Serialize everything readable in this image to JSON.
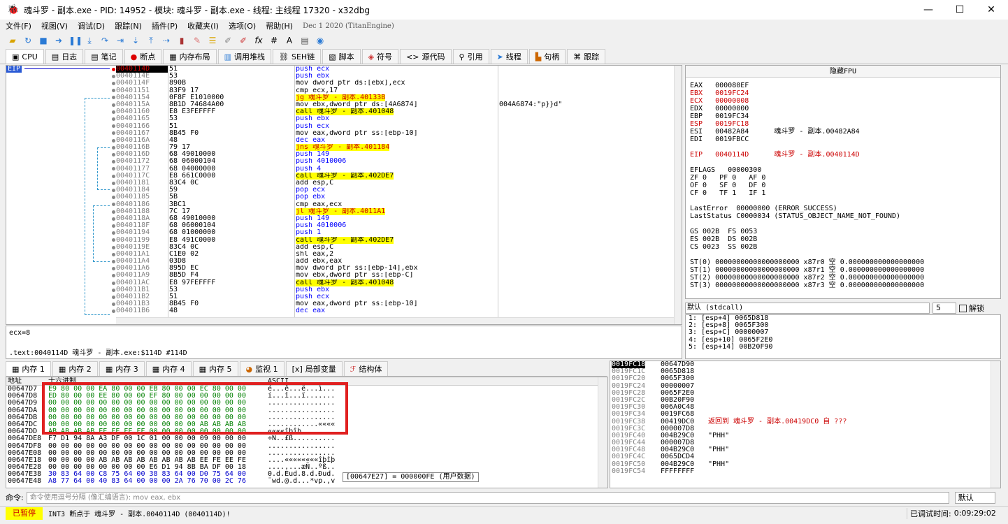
{
  "window": {
    "title": "魂斗罗 - 副本.exe - PID: 14952 - 模块: 魂斗罗 - 副本.exe - 线程: 主线程 17320 - x32dbg"
  },
  "menu": [
    "文件(F)",
    "视图(V)",
    "调试(D)",
    "跟踪(N)",
    "插件(P)",
    "收藏夹(I)",
    "选项(O)",
    "帮助(H)"
  ],
  "menu_date": "Dec 1 2020 (TitanEngine)",
  "tabs": [
    "CPU",
    "日志",
    "笔记",
    "断点",
    "内存布局",
    "调用堆栈",
    "SEH链",
    "脚本",
    "符号",
    "源代码",
    "引用",
    "线程",
    "句柄",
    "跟踪"
  ],
  "eip_label": "EIP",
  "disasm": [
    {
      "addr": "0040114D",
      "bytes": "51",
      "asm": "push ecx",
      "kind": "blue",
      "eip": true
    },
    {
      "addr": "0040114E",
      "bytes": "53",
      "asm": "push ebx",
      "kind": "blue"
    },
    {
      "addr": "0040114F",
      "bytes": "890B",
      "asm": "mov dword ptr ds:[ebx],ecx",
      "kind": "plain"
    },
    {
      "addr": "00401151",
      "bytes": "83F9 17",
      "asm": "cmp ecx,17",
      "kind": "plain"
    },
    {
      "addr": "00401154",
      "bytes": "0F8F E1010000",
      "asm": "jg 魂斗罗 - 副本.40133B",
      "kind": "j"
    },
    {
      "addr": "0040115A",
      "bytes": "8B1D 74684A00",
      "asm": "mov ebx,dword ptr ds:[4A6874]",
      "kind": "plain",
      "cmt": "004A6874:\"p}}d\""
    },
    {
      "addr": "00401160",
      "bytes": "E8 E3FEFFFF",
      "asm": "call 魂斗罗 - 副本.401048",
      "kind": "call"
    },
    {
      "addr": "00401165",
      "bytes": "53",
      "asm": "push ebx",
      "kind": "blue"
    },
    {
      "addr": "00401166",
      "bytes": "51",
      "asm": "push ecx",
      "kind": "blue"
    },
    {
      "addr": "00401167",
      "bytes": "8B45 F0",
      "asm": "mov eax,dword ptr ss:[ebp-10]",
      "kind": "plain"
    },
    {
      "addr": "0040116A",
      "bytes": "48",
      "asm": "dec eax",
      "kind": "blue"
    },
    {
      "addr": "0040116B",
      "bytes": "79 17",
      "asm": "jns 魂斗罗 - 副本.401184",
      "kind": "j"
    },
    {
      "addr": "0040116D",
      "bytes": "68 49010000",
      "asm": "push 149",
      "kind": "blue"
    },
    {
      "addr": "00401172",
      "bytes": "68 06000104",
      "asm": "push 4010006",
      "kind": "blue"
    },
    {
      "addr": "00401177",
      "bytes": "68 04000000",
      "asm": "push 4",
      "kind": "blue"
    },
    {
      "addr": "0040117C",
      "bytes": "E8 661C0000",
      "asm": "call 魂斗罗 - 副本.402DE7",
      "kind": "call"
    },
    {
      "addr": "00401181",
      "bytes": "83C4 0C",
      "asm": "add esp,C",
      "kind": "plain"
    },
    {
      "addr": "00401184",
      "bytes": "59",
      "asm": "pop ecx",
      "kind": "blue"
    },
    {
      "addr": "00401185",
      "bytes": "5B",
      "asm": "pop ebx",
      "kind": "blue"
    },
    {
      "addr": "00401186",
      "bytes": "3BC1",
      "asm": "cmp eax,ecx",
      "kind": "plain"
    },
    {
      "addr": "00401188",
      "bytes": "7C 17",
      "asm": "jl 魂斗罗 - 副本.4011A1",
      "kind": "j"
    },
    {
      "addr": "0040118A",
      "bytes": "68 49010000",
      "asm": "push 149",
      "kind": "blue"
    },
    {
      "addr": "0040118F",
      "bytes": "68 06000104",
      "asm": "push 4010006",
      "kind": "blue"
    },
    {
      "addr": "00401194",
      "bytes": "68 01000000",
      "asm": "push 1",
      "kind": "blue"
    },
    {
      "addr": "00401199",
      "bytes": "E8 491C0000",
      "asm": "call 魂斗罗 - 副本.402DE7",
      "kind": "call"
    },
    {
      "addr": "0040119E",
      "bytes": "83C4 0C",
      "asm": "add esp,C",
      "kind": "plain"
    },
    {
      "addr": "004011A1",
      "bytes": "C1E0 02",
      "asm": "shl eax,2",
      "kind": "plain"
    },
    {
      "addr": "004011A4",
      "bytes": "03D8",
      "asm": "add ebx,eax",
      "kind": "plain"
    },
    {
      "addr": "004011A6",
      "bytes": "895D EC",
      "asm": "mov dword ptr ss:[ebp-14],ebx",
      "kind": "plain"
    },
    {
      "addr": "004011A9",
      "bytes": "8B5D F4",
      "asm": "mov ebx,dword ptr ss:[ebp-C]",
      "kind": "plain"
    },
    {
      "addr": "004011AC",
      "bytes": "E8 97FEFFFF",
      "asm": "call 魂斗罗 - 副本.401048",
      "kind": "call"
    },
    {
      "addr": "004011B1",
      "bytes": "53",
      "asm": "push ebx",
      "kind": "blue"
    },
    {
      "addr": "004011B2",
      "bytes": "51",
      "asm": "push ecx",
      "kind": "blue"
    },
    {
      "addr": "004011B3",
      "bytes": "8B45 F0",
      "asm": "mov eax,dword ptr ss:[ebp-10]",
      "kind": "plain"
    },
    {
      "addr": "004011B6",
      "bytes": "48",
      "asm": "dec eax",
      "kind": "blue"
    }
  ],
  "info": {
    "line1": "ecx=8",
    "line2": ".text:0040114D 魂斗罗 - 副本.exe:$114D #114D"
  },
  "registers": {
    "header": "隐藏FPU",
    "lines": [
      {
        "t": "EAX   000080EF",
        "red": false
      },
      {
        "t": "EBX   0019FC24",
        "red": true
      },
      {
        "t": "ECX   00000008",
        "red": true
      },
      {
        "t": "EDX   00000000",
        "red": false
      },
      {
        "t": "EBP   0019FC34",
        "red": false
      },
      {
        "t": "ESP   0019FC18",
        "red": true
      },
      {
        "t": "ESI   00482A84      魂斗罗 - 副本.00482A84",
        "red": false
      },
      {
        "t": "EDI   0019FBCC",
        "red": false
      },
      {
        "t": "",
        "red": false
      },
      {
        "t": "EIP   0040114D      魂斗罗 - 副本.0040114D",
        "red": true
      },
      {
        "t": "",
        "red": false
      },
      {
        "t": "EFLAGS   00000300",
        "red": false
      },
      {
        "t": "ZF 0   PF 0   AF 0",
        "red": false
      },
      {
        "t": "OF 0   SF 0   DF 0",
        "red": false
      },
      {
        "t": "CF 0   TF 1   IF 1",
        "red": false
      },
      {
        "t": "",
        "red": false
      },
      {
        "t": "LastError  00000000 (ERROR_SUCCESS)",
        "red": false
      },
      {
        "t": "LastStatus C0000034 (STATUS_OBJECT_NAME_NOT_FOUND)",
        "red": false
      },
      {
        "t": "",
        "red": false
      },
      {
        "t": "GS 002B  FS 0053",
        "red": false
      },
      {
        "t": "ES 002B  DS 002B",
        "red": false
      },
      {
        "t": "CS 0023  SS 002B",
        "red": false
      },
      {
        "t": "",
        "red": false
      },
      {
        "t": "ST(0) 00000000000000000000 x87r0 空 0.000000000000000000",
        "red": false
      },
      {
        "t": "ST(1) 00000000000000000000 x87r1 空 0.000000000000000000",
        "red": false
      },
      {
        "t": "ST(2) 00000000000000000000 x87r2 空 0.000000000000000000",
        "red": false
      },
      {
        "t": "ST(3) 00000000000000000000 x87r3 空 0.000000000000000000",
        "red": false
      }
    ]
  },
  "callconv": {
    "label": "默认 (stdcall)",
    "count": "5",
    "unlock": "解锁"
  },
  "stack_args": [
    "1: [esp+4] 0065D818",
    "2: [esp+8] 0065F300",
    "3: [esp+C] 00000007",
    "4: [esp+10] 0065F2E0",
    "5: [esp+14] 00B20F90"
  ],
  "memtabs": [
    "内存 1",
    "内存 2",
    "内存 3",
    "内存 4",
    "内存 5",
    "监视 1",
    "局部变量",
    "结构体"
  ],
  "dump": {
    "hdr_addr": "地址",
    "hdr_hex": "十六进制",
    "hdr_ascii": "ASCII",
    "rows": [
      {
        "a": "00647D7",
        "h": "E9 80 00 00 EA 80 00 00 EB 80 00 00 EC 80 00 00",
        "s": "é...ê...ë...ì..."
      },
      {
        "a": "00647D8",
        "h": "ED 80 00 00 EE 80 00 00 EF 80 00 00 00 00 00 00",
        "s": "í...î...ï......."
      },
      {
        "a": "00647D9",
        "h": "00 00 00 00 00 00 00 00 00 00 00 00 00 00 00 00",
        "s": "................"
      },
      {
        "a": "00647DA",
        "h": "00 00 00 00 00 00 00 00 00 00 00 00 00 00 00 00",
        "s": "................"
      },
      {
        "a": "00647DB",
        "h": "00 00 00 00 00 00 00 00 00 00 00 00 00 00 00 00",
        "s": "................"
      },
      {
        "a": "00647DC",
        "h": "00 00 00 00 00 00 00 00 00 00 00 00 AB AB AB AB",
        "s": "............««««"
      },
      {
        "a": "00647DD",
        "h": "AB AB AB AB EE FE EE FE 00 00 00 00 00 00 00 00",
        "s": "««««îþîþ........"
      },
      {
        "a": "00647DE8",
        "h": "F7 D1 94 8A A3 DF 00 1C 01 00 00 00 09 00 00 00",
        "s": "÷Ñ..£ß.........."
      },
      {
        "a": "00647DF8",
        "h": "00 00 00 00 00 00 00 00 00 00 00 00 00 00 00 00",
        "s": "................"
      },
      {
        "a": "00647E08",
        "h": "00 00 00 00 00 00 00 00 00 00 00 00 00 00 00 00",
        "s": "................"
      },
      {
        "a": "00647E18",
        "h": "00 00 00 00 AB AB AB AB AB AB AB AB EE FE EE FE",
        "s": "....««««««««îþîþ"
      },
      {
        "a": "00647E28",
        "h": "00 00 00 00 00 00 00 00 E6 D1 94 8B BA DF 00 18",
        "s": "........æÑ..ºß.."
      },
      {
        "a": "00647E38",
        "h": "30 83 64 00 C8 75 64 00 38 83 64 00 D0 75 64 00",
        "s": "0.d.Èud.8.d.Ðud."
      },
      {
        "a": "00647E48",
        "h": "A8 77 64 00 40 83 64 00 00 00 2A 76 70 00 2C 76",
        "s": "¨wd.@.d...*vp.,v"
      }
    ]
  },
  "tooltip": "[00647E27] = 000000FE (用户数据)",
  "stack": {
    "rows": [
      {
        "a": "0019FC18",
        "v": "00647D90",
        "c": "",
        "cur": true
      },
      {
        "a": "0019FC1C",
        "v": "0065D818",
        "c": ""
      },
      {
        "a": "0019FC20",
        "v": "0065F300",
        "c": ""
      },
      {
        "a": "0019FC24",
        "v": "00000007",
        "c": ""
      },
      {
        "a": "0019FC28",
        "v": "0065F2E0",
        "c": ""
      },
      {
        "a": "0019FC2C",
        "v": "00B20F90",
        "c": ""
      },
      {
        "a": "0019FC30",
        "v": "006A0C48",
        "c": ""
      },
      {
        "a": "0019FC34",
        "v": "0019FC68",
        "c": ""
      },
      {
        "a": "0019FC38",
        "v": "00419DC0",
        "c": "返回到 魂斗罗 - 副本.00419DC0 自 ???",
        "red": true
      },
      {
        "a": "0019FC3C",
        "v": "000007D8",
        "c": ""
      },
      {
        "a": "0019FC40",
        "v": "004B29C0",
        "c": "\"PHH\""
      },
      {
        "a": "0019FC44",
        "v": "000007D8",
        "c": ""
      },
      {
        "a": "0019FC48",
        "v": "004B29C0",
        "c": "\"PHH\""
      },
      {
        "a": "0019FC4C",
        "v": "0065DCD4",
        "c": ""
      },
      {
        "a": "0019FC50",
        "v": "004B29C0",
        "c": "\"PHH\""
      },
      {
        "a": "0019FC54",
        "v": "FFFFFFFF",
        "c": ""
      }
    ]
  },
  "cmd": {
    "label": "命令:",
    "placeholder": "命令使用逗号分隔 (像汇编语言): mov eax, ebx",
    "mode": "默认"
  },
  "status": {
    "paused": "已暂停",
    "message": "INT3 断点于 魂斗罗 - 副本.0040114D (0040114D)!",
    "time_label": "已调试时间:",
    "time": "0:09:29:02"
  }
}
